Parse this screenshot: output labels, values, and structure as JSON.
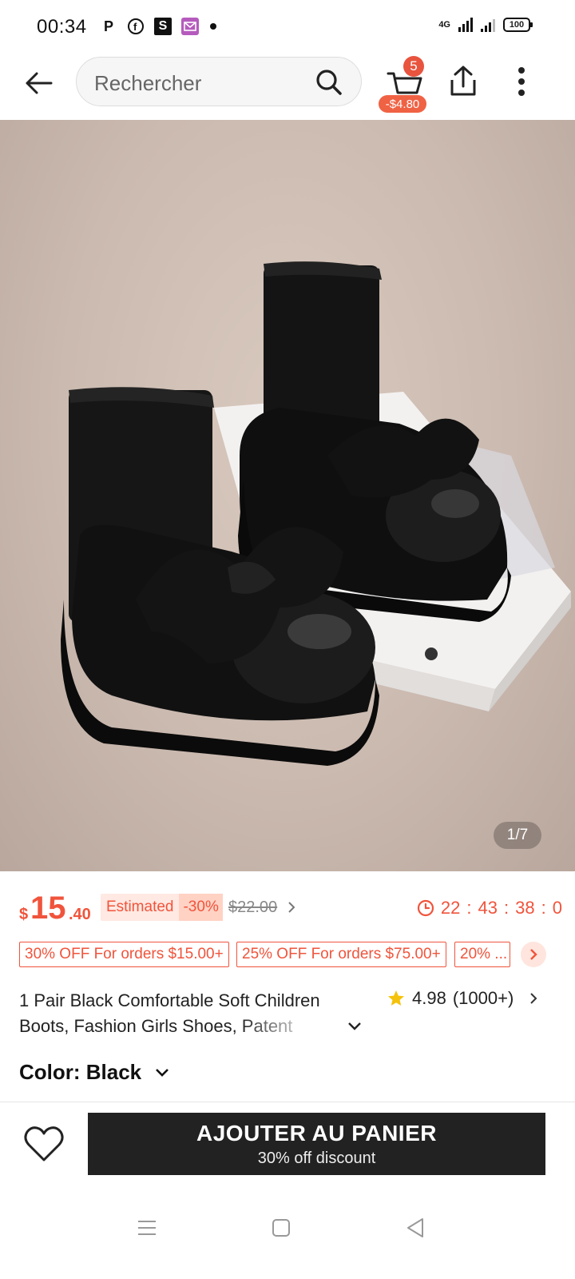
{
  "status_bar": {
    "time": "00:34",
    "app_icons": [
      "P",
      "f",
      "S",
      "mail-icon"
    ],
    "network": "4G",
    "battery": "100"
  },
  "header": {
    "search_placeholder": "Rechercher",
    "cart_count": "5",
    "cart_discount": "-$4.80"
  },
  "gallery": {
    "counter": "1/7"
  },
  "price": {
    "currency": "$",
    "main": "15",
    "cents": ".40",
    "estimated_label": "Estimated",
    "estimated_pct": "-30%",
    "original": "$22.00",
    "countdown": [
      "22",
      ":",
      "43",
      ":",
      "38",
      ":",
      "0"
    ]
  },
  "coupons": [
    "30% OFF For orders $15.00+",
    "25% OFF For orders $75.00+",
    "20% ..."
  ],
  "product": {
    "title": "1 Pair Black Comfortable Soft Children Boots, Fashion Girls Shoes, Patent",
    "rating": "4.98",
    "rating_count": "(1000+)",
    "color_label": "Color: Black"
  },
  "actions": {
    "add_to_cart": "AJOUTER AU PANIER",
    "add_to_cart_sub": "30% off discount"
  },
  "colors": {
    "accent": "#f0543c",
    "button": "#222222",
    "star": "#f5c20b"
  }
}
